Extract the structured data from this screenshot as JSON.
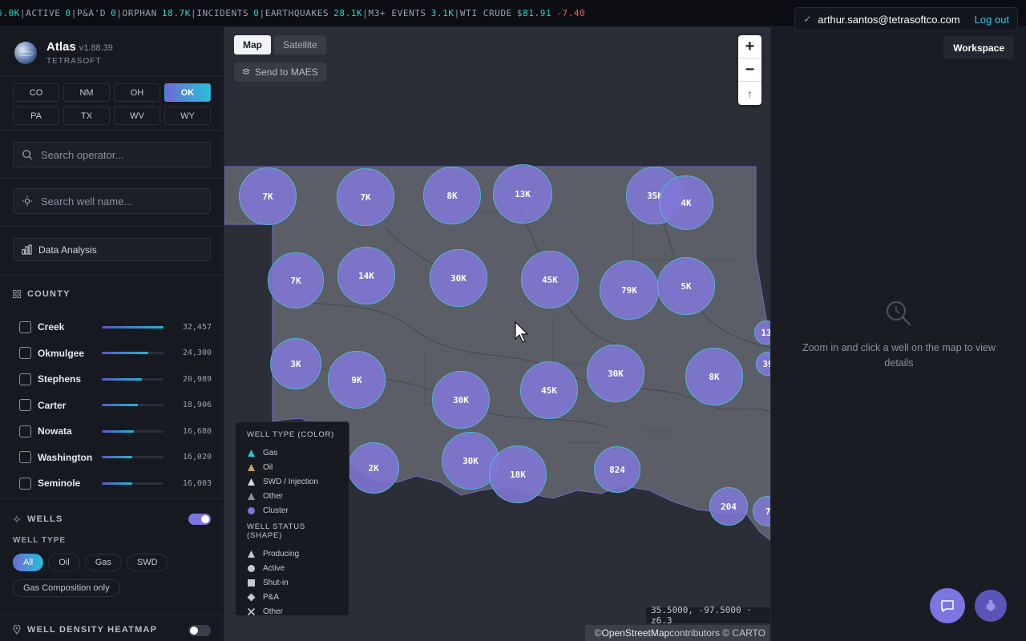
{
  "ticker": [
    {
      "label": "",
      "value": "6.0K",
      "change": ""
    },
    {
      "label": "ACTIVE",
      "value": "0",
      "change": ""
    },
    {
      "label": "P&A'D",
      "value": "0",
      "change": ""
    },
    {
      "label": "ORPHAN",
      "value": "18.7K",
      "change": ""
    },
    {
      "label": "INCIDENTS",
      "value": "0",
      "change": ""
    },
    {
      "label": "EARTHQUAKES",
      "value": "28.1K",
      "change": ""
    },
    {
      "label": "M3+ EVENTS",
      "value": "3.1K",
      "change": ""
    },
    {
      "label": "WTI CRUDE",
      "value": "$81.91",
      "change": "-7.40"
    }
  ],
  "user": {
    "check": "✓",
    "email": "arthur.santos@tetrasoftco.com",
    "logout": "Log out"
  },
  "brand": {
    "name": "Atlas",
    "version": "v1.88.39",
    "org": "TETRASOFT"
  },
  "states": [
    "CO",
    "NM",
    "OH",
    "OK",
    "PA",
    "TX",
    "WV",
    "WY"
  ],
  "active_state": "OK",
  "search": {
    "operator_placeholder": "Search operator...",
    "well_placeholder": "Search well name..."
  },
  "data_analysis_label": "Data Analysis",
  "county": {
    "title": "COUNTY",
    "rows": [
      {
        "name": "Creek",
        "value": "32,457"
      },
      {
        "name": "Okmulgee",
        "value": "24,300"
      },
      {
        "name": "Stephens",
        "value": "20,989"
      },
      {
        "name": "Carter",
        "value": "18,906"
      },
      {
        "name": "Nowata",
        "value": "16,680"
      },
      {
        "name": "Washington",
        "value": "16,020"
      },
      {
        "name": "Seminole",
        "value": "16,003"
      }
    ]
  },
  "wells": {
    "title": "WELLS",
    "toggle_on": true,
    "well_type_label": "WELL TYPE",
    "types": [
      "All",
      "Oil",
      "Gas",
      "SWD"
    ],
    "active_type": "All",
    "gas_composition": "Gas Composition only"
  },
  "heatmap": {
    "title": "WELL DENSITY HEATMAP",
    "toggle_on": false
  },
  "map": {
    "modes": [
      "Map",
      "Satellite"
    ],
    "active_mode": "Map",
    "send_maes": "Send to MAES",
    "zoom_in": "+",
    "zoom_out": "−",
    "compass": "↑",
    "coords": "35.5000, -97.5000 · z6.3",
    "attribution": {
      "copy": "© ",
      "osm": "OpenStreetMap",
      "rest": " contributors © CARTO"
    },
    "clusters": [
      "7K",
      "7K",
      "8K",
      "13K",
      "35K",
      "4K",
      "7K",
      "14K",
      "30K",
      "45K",
      "79K",
      "5K",
      "13",
      "3K",
      "9K",
      "30K",
      "45K",
      "30K",
      "8K",
      "39",
      "2K",
      "30K",
      "18K",
      "824",
      "204",
      "7"
    ]
  },
  "legend": {
    "type_title": "WELL TYPE (COLOR)",
    "types": [
      {
        "label": "Gas",
        "color": "#22c3d6"
      },
      {
        "label": "Oil",
        "color": "#c8a06a"
      },
      {
        "label": "SWD / Injection",
        "color": "#d8dbe2"
      },
      {
        "label": "Other",
        "color": "#8a8f9c"
      },
      {
        "label": "Cluster",
        "color": "#7b76e0"
      }
    ],
    "status_title": "WELL STATUS (SHAPE)",
    "statuses": [
      {
        "label": "Producing",
        "shape": "triangle"
      },
      {
        "label": "Active",
        "shape": "circle"
      },
      {
        "label": "Shut-in",
        "shape": "square"
      },
      {
        "label": "P&A",
        "shape": "diamond"
      },
      {
        "label": "Other",
        "shape": "cross"
      }
    ]
  },
  "panel": {
    "workspace": "Workspace",
    "empty_text": "Zoom in and click a well on the map to view details"
  },
  "colors": {
    "accent": "#7b76e0",
    "teal": "#2dd4c8",
    "negative": "#e06767",
    "link": "#2ec7e6"
  }
}
